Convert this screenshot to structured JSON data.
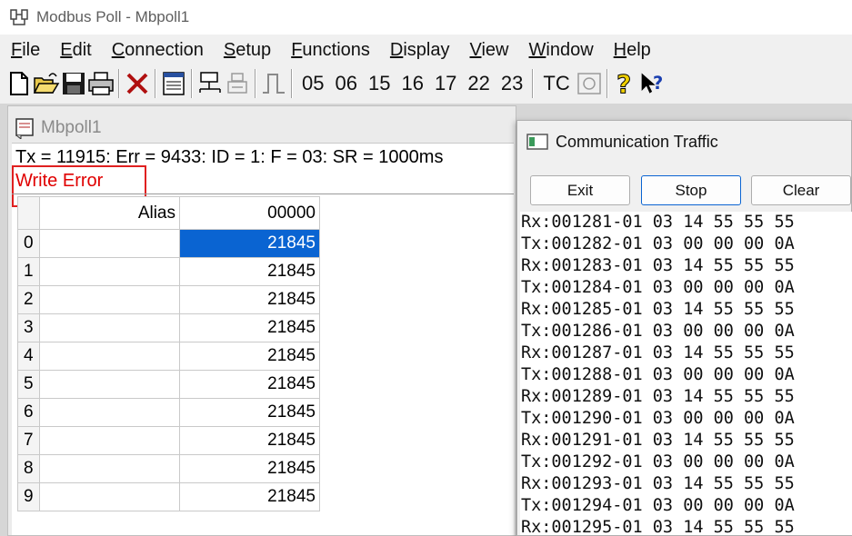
{
  "window": {
    "title": "Modbus Poll - Mbpoll1"
  },
  "menu": [
    {
      "mnemonic": "F",
      "rest": "ile"
    },
    {
      "mnemonic": "E",
      "rest": "dit"
    },
    {
      "mnemonic": "C",
      "rest": "onnection"
    },
    {
      "mnemonic": "S",
      "rest": "etup"
    },
    {
      "mnemonic": "F",
      "rest": "unctions"
    },
    {
      "mnemonic": "D",
      "rest": "isplay"
    },
    {
      "mnemonic": "V",
      "rest": "iew"
    },
    {
      "mnemonic": "W",
      "rest": "indow"
    },
    {
      "mnemonic": "H",
      "rest": "elp"
    }
  ],
  "toolbar": {
    "function_codes": [
      "05",
      "06",
      "15",
      "16",
      "17",
      "22",
      "23"
    ],
    "tc_label": "TC"
  },
  "child": {
    "title": "Mbpoll1",
    "status": "Tx = 11915: Err = 9433: ID = 1: F = 03: SR = 1000ms",
    "error": "Write Error",
    "columns": {
      "alias": "Alias",
      "address": "00000"
    },
    "rows": [
      {
        "index": "0",
        "alias": "",
        "value": "21845"
      },
      {
        "index": "1",
        "alias": "",
        "value": "21845"
      },
      {
        "index": "2",
        "alias": "",
        "value": "21845"
      },
      {
        "index": "3",
        "alias": "",
        "value": "21845"
      },
      {
        "index": "4",
        "alias": "",
        "value": "21845"
      },
      {
        "index": "5",
        "alias": "",
        "value": "21845"
      },
      {
        "index": "6",
        "alias": "",
        "value": "21845"
      },
      {
        "index": "7",
        "alias": "",
        "value": "21845"
      },
      {
        "index": "8",
        "alias": "",
        "value": "21845"
      },
      {
        "index": "9",
        "alias": "",
        "value": "21845"
      }
    ]
  },
  "traffic": {
    "title": "Communication Traffic",
    "buttons": {
      "exit": "Exit",
      "stop": "Stop",
      "clear": "Clear"
    },
    "lines": [
      "Rx:001281-01 03 14 55 55 55",
      "Tx:001282-01 03 00 00 00 0A",
      "Rx:001283-01 03 14 55 55 55",
      "Tx:001284-01 03 00 00 00 0A",
      "Rx:001285-01 03 14 55 55 55",
      "Tx:001286-01 03 00 00 00 0A",
      "Rx:001287-01 03 14 55 55 55",
      "Tx:001288-01 03 00 00 00 0A",
      "Rx:001289-01 03 14 55 55 55",
      "Tx:001290-01 03 00 00 00 0A",
      "Rx:001291-01 03 14 55 55 55",
      "Tx:001292-01 03 00 00 00 0A",
      "Rx:001293-01 03 14 55 55 55",
      "Tx:001294-01 03 00 00 00 0A",
      "Rx:001295-01 03 14 55 55 55"
    ]
  },
  "colors": {
    "selection": "#0a64d2",
    "error": "#e00000",
    "highlight_box": "#e02020"
  }
}
